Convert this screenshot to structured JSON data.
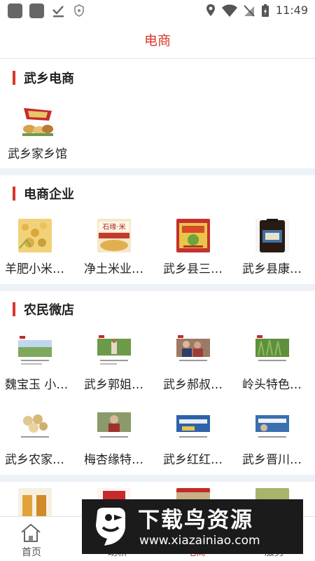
{
  "status_bar": {
    "time": "11:49"
  },
  "header": {
    "title": "电商"
  },
  "sections": [
    {
      "title": "武乡电商",
      "items": [
        {
          "label": "武乡家乡馆"
        }
      ]
    },
    {
      "title": "电商企业",
      "items": [
        {
          "label": "羊肥小米…"
        },
        {
          "label": "净土米业…"
        },
        {
          "label": "武乡县三…"
        },
        {
          "label": "武乡县康…"
        }
      ]
    },
    {
      "title": "农民微店",
      "items": [
        {
          "label": "魏宝玉 小…"
        },
        {
          "label": "武乡郭姐…"
        },
        {
          "label": "武乡郝叔…"
        },
        {
          "label": "岭头特色…"
        },
        {
          "label": "武乡农家…"
        },
        {
          "label": "梅杏缘特…"
        },
        {
          "label": "武乡红红…"
        },
        {
          "label": "武乡晋川…"
        }
      ]
    }
  ],
  "thumb_text": {
    "rice_bag": "石缘·米"
  },
  "tabbar": {
    "tabs": [
      {
        "label": "首页"
      },
      {
        "label": "助耕"
      },
      {
        "label": "电商"
      },
      {
        "label": "服务"
      }
    ]
  },
  "watermark": {
    "main": "下载鸟资源",
    "url": "www.xiazainiao.com"
  },
  "colors": {
    "accent": "#d9362b",
    "divider": "#edf1f8"
  }
}
